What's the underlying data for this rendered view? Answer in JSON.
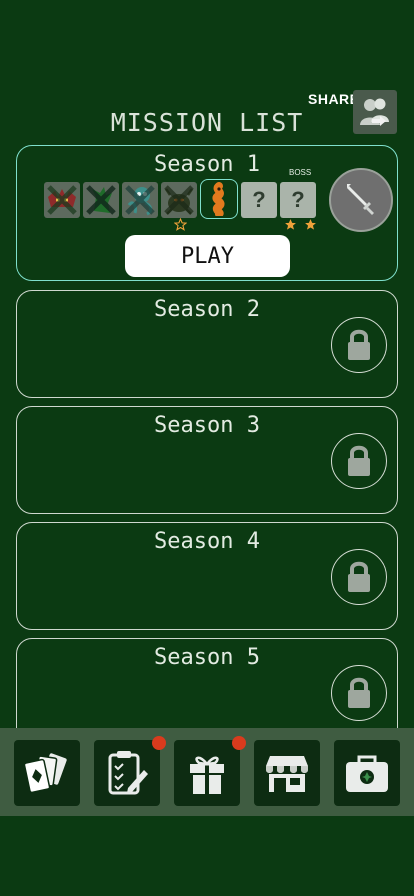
{
  "header": {
    "share_label": "SHARE",
    "title": "MISSION LIST"
  },
  "seasons": [
    {
      "name": "Season 1",
      "unlocked": true,
      "boss_label": "BOSS",
      "play_label": "PLAY",
      "levels": [
        {
          "state": "done",
          "icon": "bat-monster-icon"
        },
        {
          "state": "done",
          "icon": "green-creature-icon"
        },
        {
          "state": "done",
          "icon": "blue-octopus-icon"
        },
        {
          "state": "done",
          "icon": "dark-beetle-icon",
          "stars": 1
        },
        {
          "state": "current",
          "icon": "orange-worm-icon"
        },
        {
          "state": "locked",
          "icon": "question-mark-icon",
          "label": "?"
        },
        {
          "state": "locked",
          "icon": "question-mark-icon",
          "label": "?",
          "boss": true,
          "stars": 2
        }
      ]
    },
    {
      "name": "Season 2",
      "unlocked": false
    },
    {
      "name": "Season 3",
      "unlocked": false
    },
    {
      "name": "Season 4",
      "unlocked": false
    },
    {
      "name": "Season 5",
      "unlocked": false
    }
  ],
  "bottom_nav": [
    {
      "icon": "cards-icon",
      "badge": false
    },
    {
      "icon": "clipboard-checklist-icon",
      "badge": true
    },
    {
      "icon": "gift-icon",
      "badge": true
    },
    {
      "icon": "shop-icon",
      "badge": false
    },
    {
      "icon": "medkit-icon",
      "badge": false
    }
  ],
  "colors": {
    "background": "#0b3a12",
    "active_border": "#7fe0cd",
    "badge": "#d93b1d",
    "star": "#f0a23a",
    "bottom_bar": "#3f5c41"
  }
}
